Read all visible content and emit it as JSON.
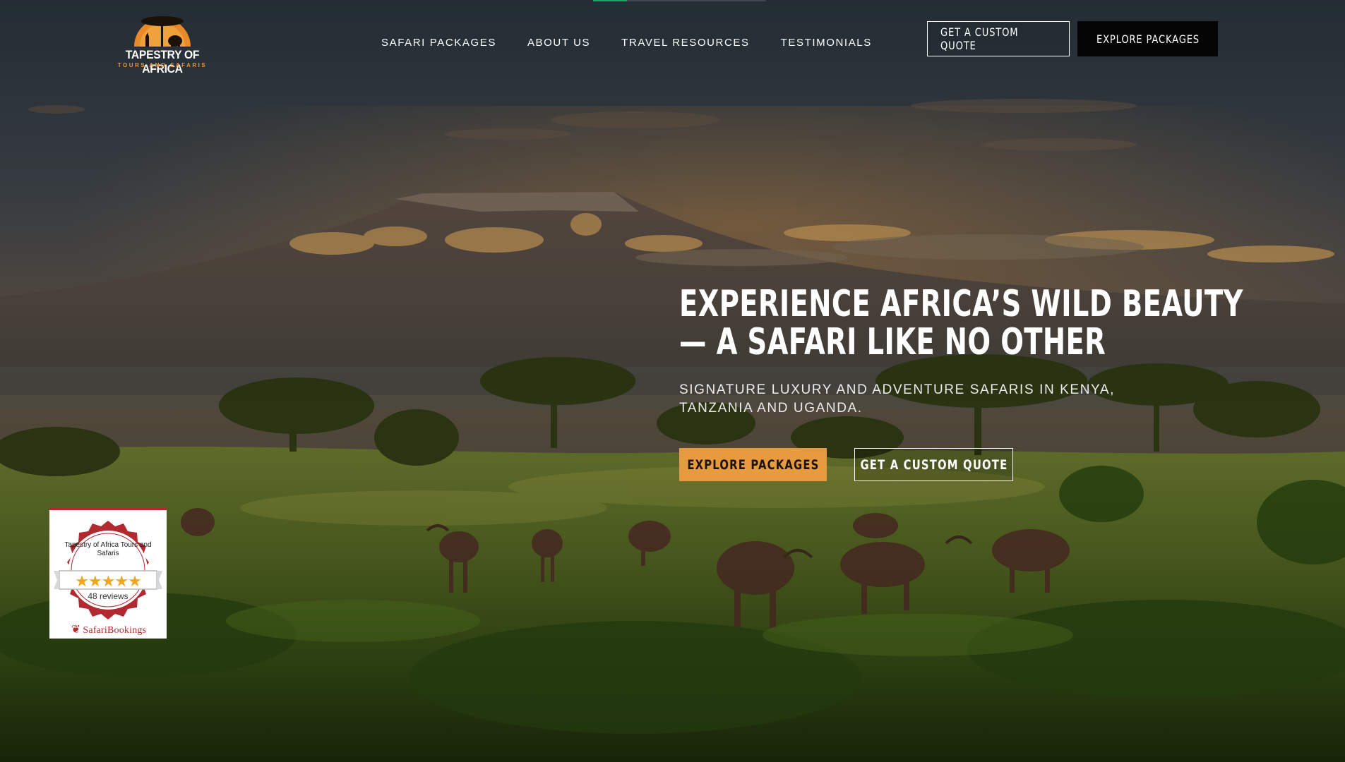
{
  "header": {
    "logo": {
      "title": "TAPESTRY OF AFRICA",
      "subtitle": "TOURS AND SAFARIS"
    },
    "nav": [
      {
        "label": "SAFARI PACKAGES"
      },
      {
        "label": "ABOUT US"
      },
      {
        "label": "TRAVEL RESOURCES"
      },
      {
        "label": "TESTIMONIALS"
      }
    ],
    "quote_button": "GET A CUSTOM QUOTE",
    "packages_button": "EXPLORE PACKAGES"
  },
  "hero": {
    "headline_line1": "EXPERIENCE AFRICA’S WILD BEAUTY",
    "headline_line2": "— A SAFARI LIKE NO OTHER",
    "subheading": "SIGNATURE LUXURY AND ADVENTURE SAFARIS IN KENYA, TANZANIA AND UGANDA.",
    "primary_cta": "EXPLORE PACKAGES",
    "secondary_cta": "GET A CUSTOM QUOTE"
  },
  "badge": {
    "company": "Tapestry of Africa Tours and Safaris",
    "stars": "★★★★★",
    "reviews": "48 reviews",
    "brand": "SafariBookings"
  },
  "colors": {
    "accent_orange": "#e89a3e",
    "button_dark": "#050505",
    "badge_red": "#b02a30",
    "star_gold": "#f2a51e",
    "top_indicator_green": "#1fa46a"
  }
}
